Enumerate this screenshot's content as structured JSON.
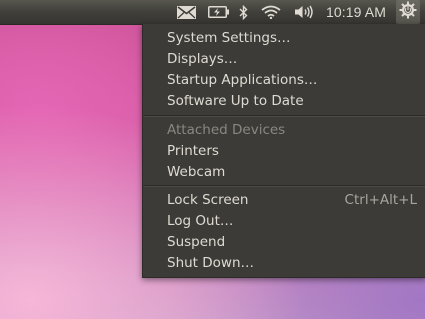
{
  "panel": {
    "indicators": [
      {
        "icon": "mail-icon"
      },
      {
        "icon": "battery-icon"
      },
      {
        "icon": "bluetooth-icon"
      },
      {
        "icon": "wifi-icon"
      },
      {
        "icon": "volume-icon"
      }
    ],
    "clock": "10:19 AM",
    "session_icon": "gear-power-icon"
  },
  "menu": {
    "section1": [
      {
        "label": "System Settings…"
      },
      {
        "label": "Displays…"
      },
      {
        "label": "Startup Applications…"
      },
      {
        "label": "Software Up to Date"
      }
    ],
    "devices_header": "Attached Devices",
    "devices": [
      {
        "label": "Printers"
      },
      {
        "label": "Webcam"
      }
    ],
    "session": [
      {
        "label": "Lock Screen",
        "shortcut": "Ctrl+Alt+L"
      },
      {
        "label": "Log Out…"
      },
      {
        "label": "Suspend"
      },
      {
        "label": "Shut Down…"
      }
    ]
  },
  "colors": {
    "panel": "#3c3b37",
    "menu_bg": "#3c3b37",
    "menu_text": "#dfdbd2",
    "disabled_text": "#8a877f"
  }
}
